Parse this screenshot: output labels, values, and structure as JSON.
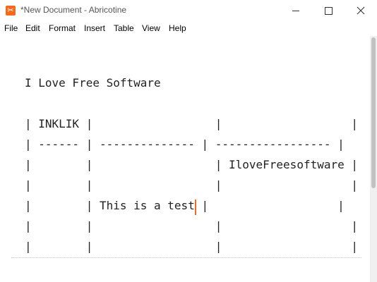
{
  "window": {
    "title": "*New Document - Abricotine",
    "app_icon": "abricotine-app-icon",
    "accent": "#f26b1d",
    "controls": {
      "minimize": "minimize-icon",
      "maximize": "maximize-icon",
      "close": "close-icon"
    }
  },
  "menu": {
    "items": [
      "File",
      "Edit",
      "Format",
      "Insert",
      "Table",
      "View",
      "Help"
    ]
  },
  "document": {
    "lines": [
      "I Love Free Software",
      "",
      "| INKLIK |                  |                   |",
      "| ------ | -------------- | ----------------- |",
      "|        |                  | IloveFreesoftware |",
      "|        |                  |                   |",
      "|        | This is a test |                   |",
      "|        |                  |                   |",
      "|        |                  |                   |"
    ]
  }
}
